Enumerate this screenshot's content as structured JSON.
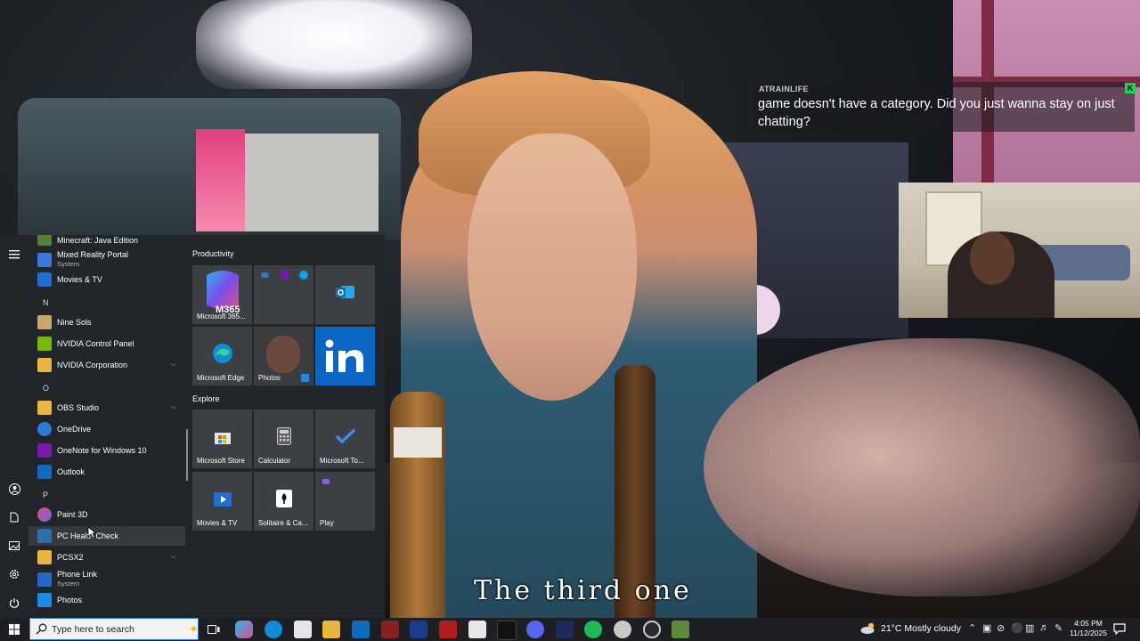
{
  "chat": {
    "username": "ATRAINLIFE",
    "message": "game doesn't have a category. Did you just wanna stay on just chatting? ",
    "badge": "K"
  },
  "subtitle": "The third one",
  "start_menu": {
    "apps": [
      {
        "name": "Minecraft: Java Edition"
      },
      {
        "name": "Mixed Reality Portal",
        "sub": "System"
      },
      {
        "name": "Movies & TV"
      },
      {
        "letter": "N"
      },
      {
        "name": "Nine Sols"
      },
      {
        "name": "NVIDIA Control Panel"
      },
      {
        "name": "NVIDIA Corporation"
      },
      {
        "letter": "O"
      },
      {
        "name": "OBS Studio"
      },
      {
        "name": "OneDrive"
      },
      {
        "name": "OneNote for Windows 10"
      },
      {
        "name": "Outlook"
      },
      {
        "letter": "P"
      },
      {
        "name": "Paint 3D"
      },
      {
        "name": "PC Health Check"
      },
      {
        "name": "PCSX2"
      },
      {
        "name": "Phone Link",
        "sub": "System"
      },
      {
        "name": "Photos"
      }
    ],
    "groups": {
      "productivity": "Productivity",
      "explore": "Explore"
    },
    "tiles": {
      "m365": "Microsoft 365...",
      "m365_badge": "M365",
      "edge": "Microsoft Edge",
      "photos": "Photos",
      "store": "Microsoft Store",
      "calculator": "Calculator",
      "todo": "Microsoft To...",
      "movies": "Movies & TV",
      "solitaire": "Solitaire & Ca...",
      "play": "Play"
    }
  },
  "taskbar": {
    "search_placeholder": "Type here to search",
    "weather": "21°C  Mostly cloudy",
    "time": "4:05 PM",
    "date": "11/12/2025"
  },
  "colors": {
    "accent": "#3a7bd5",
    "kick": "#1bd45a",
    "menu_bg": "#22262a"
  }
}
